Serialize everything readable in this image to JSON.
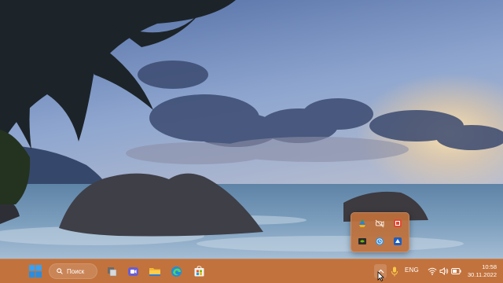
{
  "taskbar": {
    "search_label": "Поиск",
    "language": "ENG",
    "time": "10:58",
    "date": "30.11.2022",
    "color": "#c2723c",
    "pinned_apps": [
      {
        "icon": "windows-start-icon"
      },
      {
        "icon": "search-icon"
      },
      {
        "icon": "file-explorer-gray-icon"
      },
      {
        "icon": "teams-chat-icon"
      },
      {
        "icon": "file-explorer-icon"
      },
      {
        "icon": "edge-browser-icon"
      },
      {
        "icon": "microsoft-store-icon"
      }
    ],
    "tray_icons": [
      "show-hidden-icons-chevron",
      "microphone-icon",
      "wifi-icon",
      "volume-icon",
      "battery-icon"
    ]
  },
  "tray_flyout": {
    "color": "#be703a",
    "icons": [
      "google-drive-icon",
      "camera-off-icon",
      "red-app-icon",
      "nvidia-icon",
      "clock-app-icon",
      "blue-arrow-app-icon"
    ]
  },
  "wallpaper": {
    "description_colors": {
      "sky_top": "#5a73a8",
      "sun": "#f3d9a8",
      "sea": "#6f93b4"
    }
  }
}
